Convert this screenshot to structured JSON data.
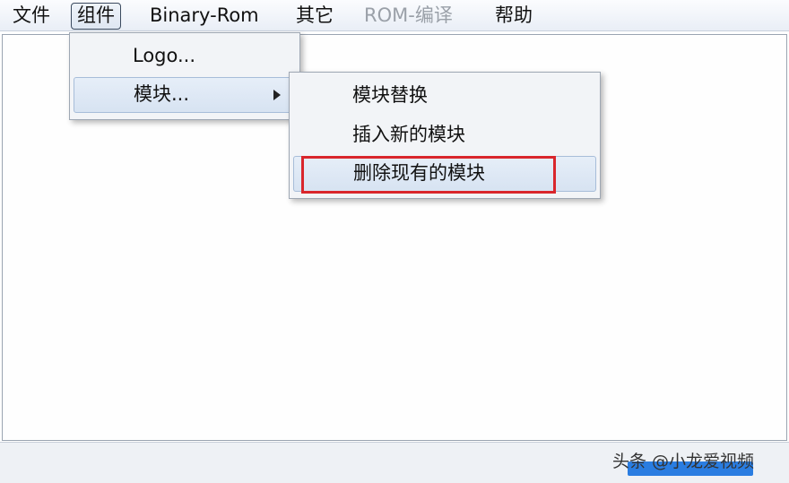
{
  "menubar": {
    "items": [
      {
        "label": "文件"
      },
      {
        "label": "组件"
      },
      {
        "label": "Binary-Rom"
      },
      {
        "label": "其它"
      },
      {
        "label": "ROM-编译"
      },
      {
        "label": "帮助"
      }
    ]
  },
  "component_menu": {
    "items": [
      {
        "label": "Logo..."
      },
      {
        "label": "模块..."
      }
    ]
  },
  "module_submenu": {
    "items": [
      {
        "label": "模块替换"
      },
      {
        "label": "插入新的模块"
      },
      {
        "label": "删除现有的模块"
      }
    ]
  },
  "watermark": "头条 @小龙爱视频",
  "colors": {
    "highlight": "#d9262c",
    "progress": "#2a7de1"
  }
}
